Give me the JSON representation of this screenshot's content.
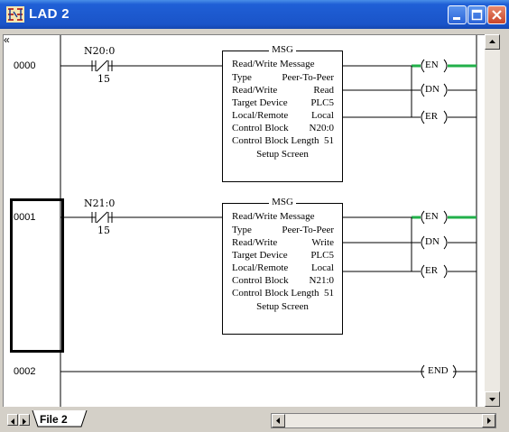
{
  "window": {
    "title": "LAD 2"
  },
  "rungs": [
    {
      "number": "0000",
      "contact_address": "N20:0",
      "contact_bit": "15",
      "msg": {
        "label": "MSG",
        "header": "Read/Write Message",
        "rows": [
          {
            "key": "Type",
            "value": "Peer-To-Peer"
          },
          {
            "key": "Read/Write",
            "value": "Read"
          },
          {
            "key": "Target Device",
            "value": "PLC5"
          },
          {
            "key": "Local/Remote",
            "value": "Local"
          },
          {
            "key": "Control Block",
            "value": "N20:0"
          },
          {
            "key": "Control Block Length",
            "value": "51"
          }
        ],
        "setup": "Setup Screen"
      },
      "outputs": [
        "EN",
        "DN",
        "ER"
      ]
    },
    {
      "number": "0001",
      "contact_address": "N21:0",
      "contact_bit": "15",
      "msg": {
        "label": "MSG",
        "header": "Read/Write Message",
        "rows": [
          {
            "key": "Type",
            "value": "Peer-To-Peer"
          },
          {
            "key": "Read/Write",
            "value": "Write"
          },
          {
            "key": "Target Device",
            "value": "PLC5"
          },
          {
            "key": "Local/Remote",
            "value": "Local"
          },
          {
            "key": "Control Block",
            "value": "N21:0"
          },
          {
            "key": "Control Block Length",
            "value": "51"
          }
        ],
        "setup": "Setup Screen"
      },
      "outputs": [
        "EN",
        "DN",
        "ER"
      ]
    },
    {
      "number": "0002",
      "end_label": "END"
    }
  ],
  "rail_marker": "«",
  "tabs": [
    {
      "label": "File 2"
    }
  ],
  "colors": {
    "titlebar": "#1f5fd6",
    "energized": "#22b04a",
    "close": "#c9452a"
  }
}
